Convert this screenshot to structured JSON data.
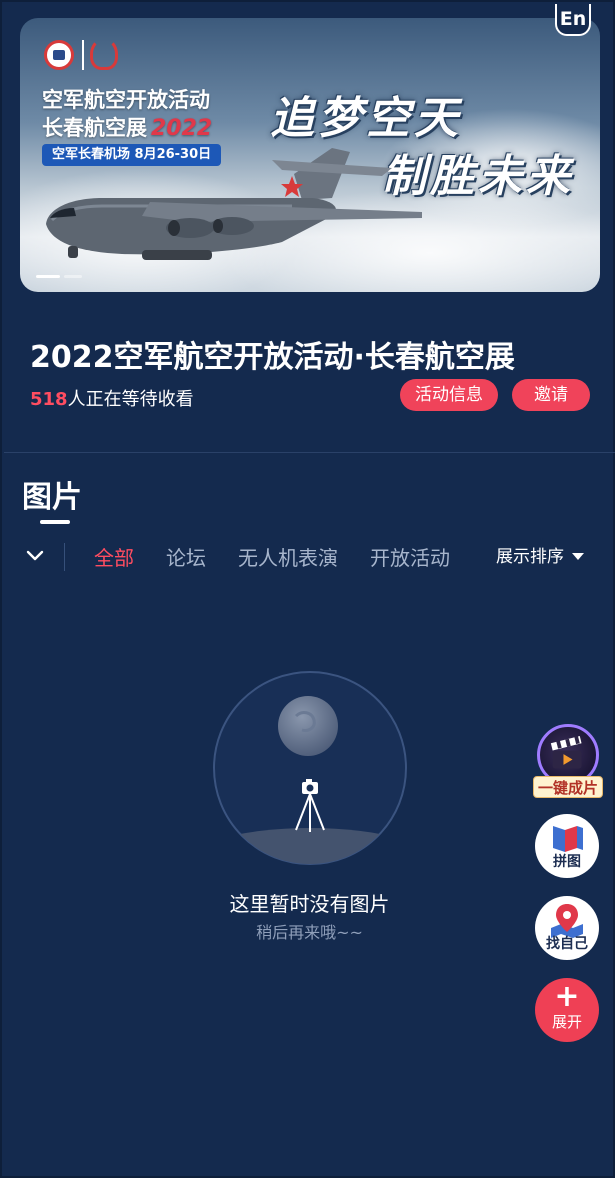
{
  "lang_button": "En",
  "banner": {
    "title_line1": "空军航空开放活动",
    "title_line2": "长春航空展",
    "year": "2022",
    "venue_date": "空军长春机场   8月26-30日",
    "slogan_line1": "追梦空天",
    "slogan_line2": "制胜未来"
  },
  "event": {
    "title": "2022空军航空开放活动·长春航空展",
    "viewer_count": "518",
    "viewer_suffix": "人正在等待收看",
    "info_button": "活动信息",
    "invite_button": "邀请"
  },
  "section": {
    "title": "图片"
  },
  "tabs": [
    {
      "label": "全部",
      "active": true
    },
    {
      "label": "论坛",
      "active": false
    },
    {
      "label": "无人机表演",
      "active": false
    },
    {
      "label": "开放活动",
      "active": false
    }
  ],
  "sort_label": "展示排序",
  "empty_state": {
    "title": "这里暂时没有图片",
    "subtitle": "稍后再来哦~~"
  },
  "floating": {
    "one_click": "一键成片",
    "collage": "拼图",
    "find_me": "找自己",
    "expand": "展开"
  },
  "colors": {
    "background": "#142a4e",
    "accent": "#f0435a"
  }
}
